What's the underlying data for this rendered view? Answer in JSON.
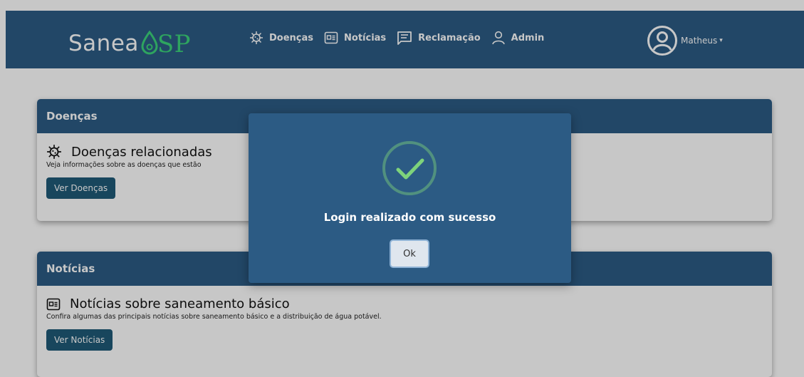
{
  "brand": {
    "prefix": "Sanea",
    "suffix": "SP"
  },
  "nav": {
    "items": [
      {
        "label": "Doenças",
        "icon": "virus-icon"
      },
      {
        "label": "Notícias",
        "icon": "newspaper-icon"
      },
      {
        "label": "Reclamação",
        "icon": "message-icon"
      },
      {
        "label": "Admin",
        "icon": "person-icon"
      }
    ],
    "user": {
      "name": "Matheus",
      "icon": "user-circle-icon"
    }
  },
  "cards": [
    {
      "header": "Doenças",
      "title": "Doenças relacionadas",
      "text": "Veja informações sobre as doenças que estão",
      "button": "Ver Doenças",
      "icon": "virus-icon"
    },
    {
      "header": "Notícias",
      "title": "Notícias sobre saneamento básico",
      "text": "Confira algumas das principais notícias sobre saneamento básico e a distribuição de água potável.",
      "button": "Ver Notícias",
      "icon": "newspaper-icon"
    }
  ],
  "modal": {
    "title": "Login realizado com sucesso",
    "ok_label": "Ok",
    "icon": "check-circle-icon"
  },
  "colors": {
    "primary": "#2c5b84",
    "button": "#1f5a78",
    "brand_accent": "#3cd27a",
    "success": "#7ed37b"
  }
}
